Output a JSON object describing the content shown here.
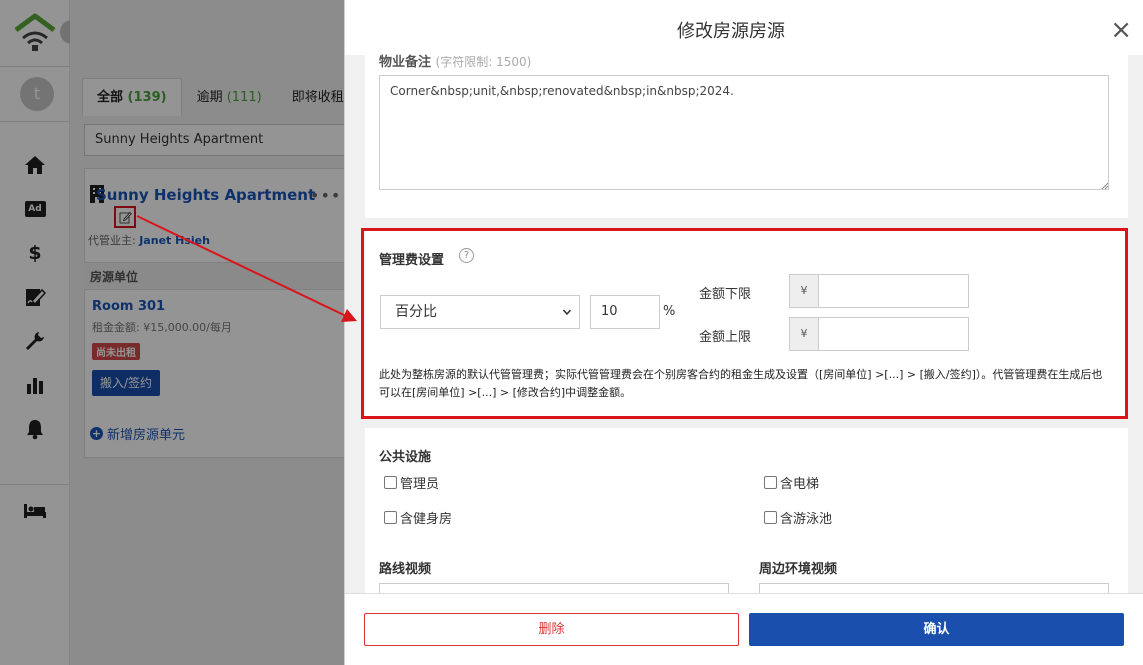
{
  "colors": {
    "accent_blue": "#1a4fae",
    "link_blue": "#1a55b8",
    "annotation_red": "#d9141b",
    "count_green": "#4aa33c",
    "badge_red": "#d14a4a"
  },
  "sidebar": {
    "avatar_letter": "t",
    "icons": [
      "home-icon",
      "ad-icon",
      "dollar-icon",
      "signature-icon",
      "wrench-icon",
      "bar-chart-icon",
      "bell-icon",
      "bed-icon"
    ],
    "ad_label": "Ad",
    "dollar_label": "$"
  },
  "tabs": [
    {
      "label": "全部",
      "count": "(139)"
    },
    {
      "label": "逾期",
      "count": "(111)"
    },
    {
      "label": "即将收租",
      "count": "("
    }
  ],
  "search": {
    "value": "Sunny Heights Apartment"
  },
  "property": {
    "title": "Sunny Heights Apartment",
    "more": "•••",
    "owner_label": "代管业主:",
    "owner_name": "Janet Hsieh",
    "unit_header": "房源单位",
    "room": "Room 301",
    "rent": "租金金额: ¥15,000.00/每月",
    "status_badge": "尚未出租",
    "move_in_button": "搬入/签约",
    "add_unit": "新增房源单元"
  },
  "modal": {
    "title": "修改房源房源",
    "close": "×",
    "notes_label": "物业备注",
    "notes_hint": "(字符限制: 1500)",
    "notes_value": "Corner&nbsp;unit,&nbsp;renovated&nbsp;in&nbsp;2024.",
    "fee": {
      "label": "管理费设置",
      "help": "?",
      "type_selected": "百分比",
      "percent_value": "10",
      "percent_sign": "%",
      "min_label": "金额下限",
      "max_label": "金额上限",
      "currency": "¥",
      "min_value": "",
      "max_value": "",
      "note": "此处为整栋房源的默认代管管理费；实际代管管理费会在个别房客合约的租金生成及设置（[房间单位] >[...] > [搬入/签约]）。代管管理费在生成后也可以在[房间单位] >[...] > [修改合约]中调整金额。"
    },
    "facilities": {
      "label": "公共设施",
      "items": [
        {
          "label": "管理员",
          "checked": false
        },
        {
          "label": "含电梯",
          "checked": false
        },
        {
          "label": "含健身房",
          "checked": false
        },
        {
          "label": "含游泳池",
          "checked": false
        }
      ]
    },
    "route_video_label": "路线视频",
    "env_video_label": "周边环境视频",
    "delete_button": "删除",
    "confirm_button": "确认"
  }
}
